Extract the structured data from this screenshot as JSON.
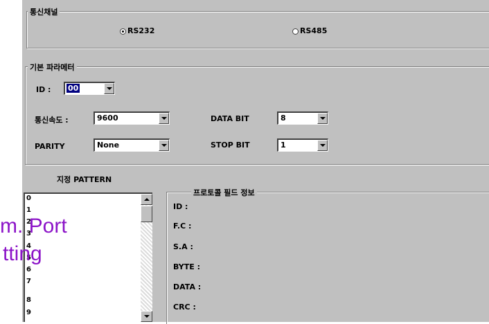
{
  "comm_channel": {
    "legend": "통신채널",
    "options": [
      "RS232",
      "RS485"
    ],
    "selected": "RS232"
  },
  "basic_params": {
    "legend": "기본 파라메터",
    "id": {
      "label": "ID :",
      "value": "00"
    },
    "baud": {
      "label": "통신속도 :",
      "value": "9600"
    },
    "parity": {
      "label": "PARITY",
      "value": "None"
    },
    "data_bit": {
      "label": "DATA BIT",
      "value": "8"
    },
    "stop_bit": {
      "label": "STOP BIT",
      "value": "1"
    }
  },
  "pattern": {
    "title": "지정 PATTERN",
    "items": [
      "0",
      "1",
      "2",
      "3",
      "4",
      "5",
      "6",
      "7",
      "8",
      "9"
    ]
  },
  "protocol": {
    "legend": "프로토콜 필드 정보",
    "fields": [
      "ID :",
      "F.C :",
      "S.A :",
      "BYTE :",
      "DATA :",
      "CRC :"
    ]
  },
  "overlay": {
    "line1": "m. Port",
    "line2": "tting"
  },
  "colors": {
    "dialog_bg": "#c0c0c0",
    "overlay_text": "#8c14c8",
    "selection": "#000080"
  }
}
